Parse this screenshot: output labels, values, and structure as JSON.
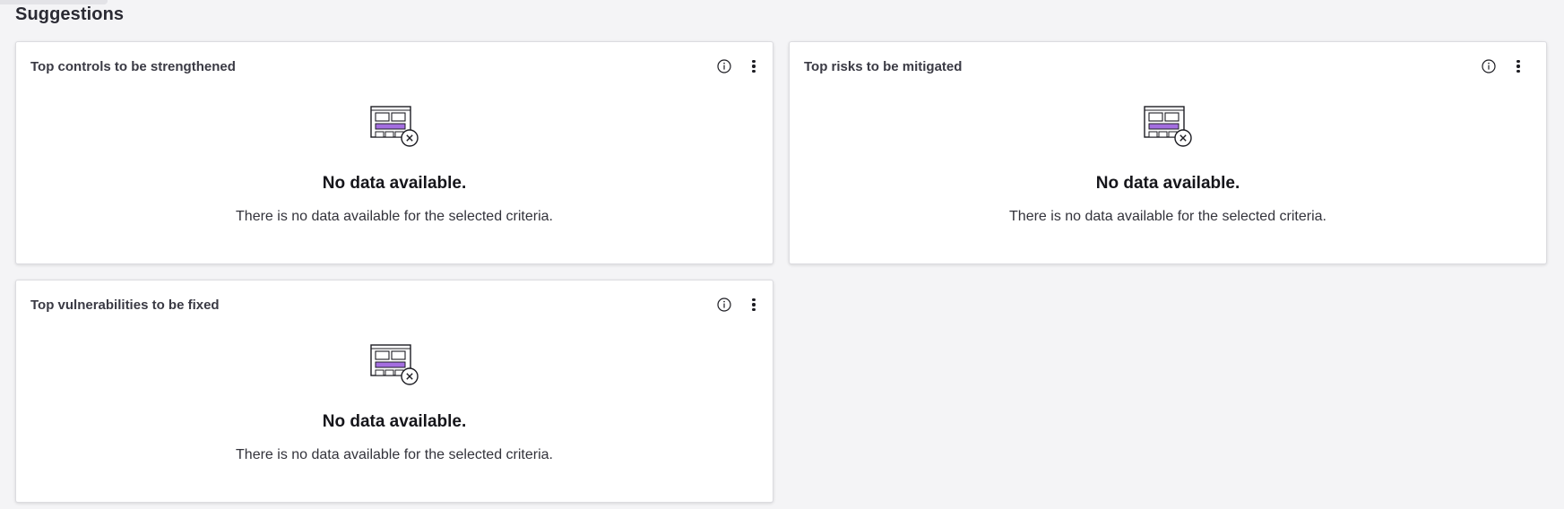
{
  "page": {
    "title": "Suggestions"
  },
  "cards": [
    {
      "title": "Top controls to be strengthened",
      "empty_title": "No data available.",
      "empty_description": "There is no data available for the selected criteria."
    },
    {
      "title": "Top risks to be mitigated",
      "empty_title": "No data available.",
      "empty_description": "There is no data available for the selected criteria."
    },
    {
      "title": "Top vulnerabilities to be fixed",
      "empty_title": "No data available.",
      "empty_description": "There is no data available for the selected criteria."
    }
  ],
  "icons": {
    "info": "info-icon",
    "menu": "more-vertical-icon",
    "empty": "no-data-illustration"
  },
  "colors": {
    "background": "#f4f4f6",
    "card": "#ffffff",
    "illustration_accent": "#a46ee0"
  }
}
